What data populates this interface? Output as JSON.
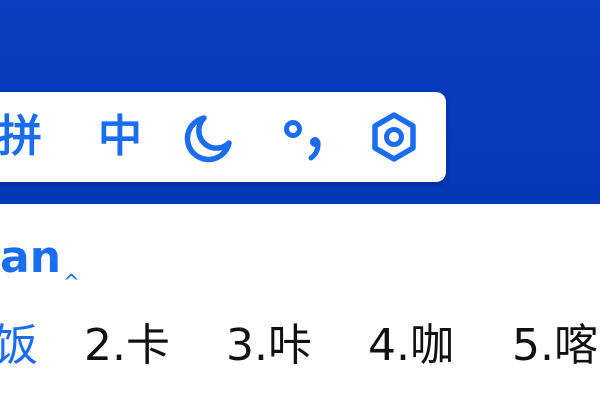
{
  "toolbar": {
    "items": [
      {
        "label": "拼",
        "icon": "pinyin-mode"
      },
      {
        "label": "中",
        "icon": "chinese-mode"
      },
      {
        "label": "",
        "icon": "moon-icon"
      },
      {
        "label": "",
        "icon": "punctuation-icon"
      },
      {
        "label": "",
        "icon": "settings-gear-icon"
      }
    ]
  },
  "colors": {
    "accent": "#1a6cf0",
    "background": "#0638b8",
    "panel": "#ffffff",
    "text": "#111111"
  },
  "candidate_window": {
    "preedit": "an",
    "cursor": "^",
    "candidates": [
      {
        "text": "饭",
        "selected": true
      },
      {
        "text": "2.卡",
        "selected": false
      },
      {
        "text": "3.咔",
        "selected": false
      },
      {
        "text": "4.咖",
        "selected": false
      },
      {
        "text": "5.喀",
        "selected": false
      }
    ]
  }
}
